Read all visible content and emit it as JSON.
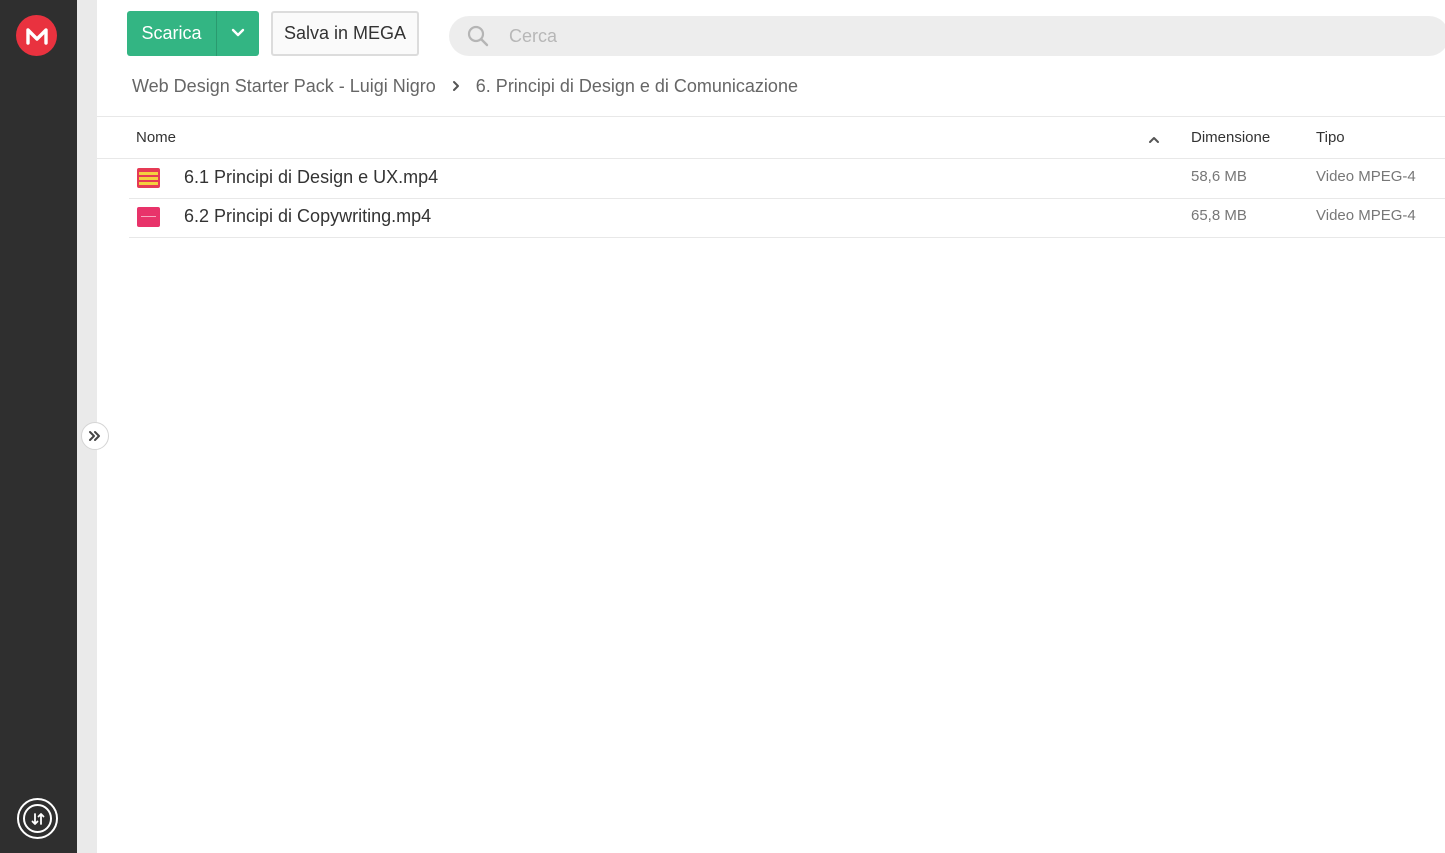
{
  "toolbar": {
    "download_label": "Scarica",
    "save_label": "Salva in MEGA",
    "search_placeholder": "Cerca"
  },
  "breadcrumb": {
    "items": [
      "Web Design Starter Pack - Luigi Nigro",
      "6. Principi di Design e di Comunicazione"
    ]
  },
  "table": {
    "columns": {
      "name": "Nome",
      "size": "Dimensione",
      "type": "Tipo"
    },
    "sort": "ascending",
    "rows": [
      {
        "name": "6.1 Principi di Design e UX.mp4",
        "size": "58,6 MB",
        "type": "Video MPEG-4"
      },
      {
        "name": "6.2 Principi di Copywriting.mp4",
        "size": "65,8 MB",
        "type": "Video MPEG-4"
      }
    ]
  },
  "icons": {
    "logo": "mega-logo-icon",
    "transfers": "transfers-icon",
    "expand": "double-chevron-right-icon",
    "search": "search-icon",
    "dropdown": "chevron-down-icon",
    "breadcrumb_separator": "chevron-right-icon",
    "sort": "chevron-up-icon"
  },
  "colors": {
    "brand_red": "#e9323f",
    "download_green": "#33b583",
    "rail_dark": "#2f2f2f"
  }
}
